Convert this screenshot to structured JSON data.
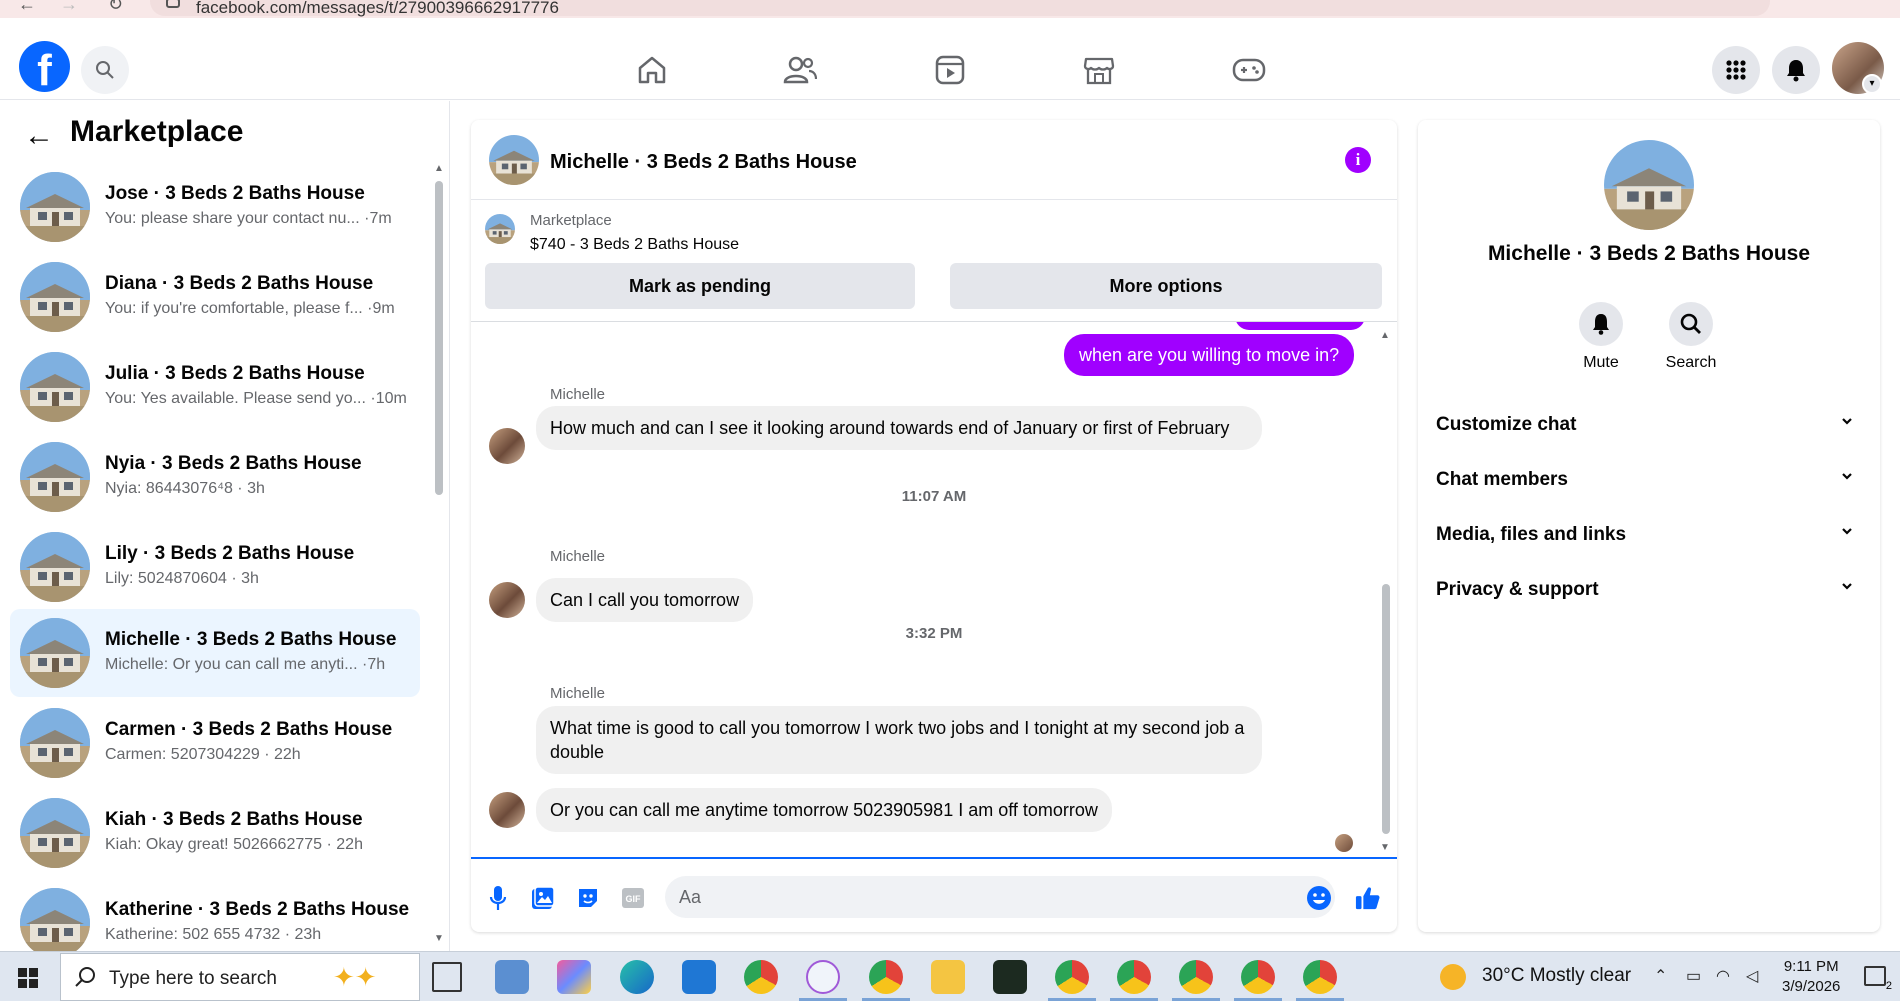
{
  "browser": {
    "url": "facebook.com/messages/t/27900396662917776"
  },
  "topnav": {
    "logo_letter": "f",
    "icons": [
      "search-icon",
      "home-icon",
      "friends-icon",
      "video-icon",
      "marketplace-icon",
      "gaming-icon",
      "apps-grid-icon",
      "notifications-icon"
    ]
  },
  "sidebar": {
    "title": "Marketplace",
    "conversations": [
      {
        "name": "Jose · 3 Beds 2 Baths House",
        "preview": "You: please share your contact nu... ·7m",
        "active": false
      },
      {
        "name": "Diana · 3 Beds 2 Baths House",
        "preview": "You: if you're comfortable, please f... ·9m",
        "active": false
      },
      {
        "name": "Julia · 3 Beds 2 Baths House",
        "preview": "You: Yes available. Please send yo... ·10m",
        "active": false
      },
      {
        "name": "Nyia · 3 Beds 2 Baths House",
        "preview": "Nyia: 86443076⁴8 · 3h",
        "active": false
      },
      {
        "name": "Lily · 3 Beds 2 Baths House",
        "preview": "Lily: 5024870604 · 3h",
        "active": false
      },
      {
        "name": "Michelle · 3 Beds 2 Baths House",
        "preview": "Michelle: Or you can call me anyti... ·7h",
        "active": true
      },
      {
        "name": "Carmen · 3 Beds 2 Baths House",
        "preview": "Carmen: 5207304229 · 22h",
        "active": false
      },
      {
        "name": "Kiah · 3 Beds 2 Baths House",
        "preview": "Kiah: Okay great! 5026662775 · 22h",
        "active": false
      },
      {
        "name": "Katherine · 3 Beds 2 Baths House",
        "preview": "Katherine: 502 655 4732 · 23h",
        "active": false
      }
    ]
  },
  "chat": {
    "title": "Michelle · 3 Beds 2 Baths House",
    "marketplace_label": "Marketplace",
    "listing": "$740 - 3 Beds 2 Baths House",
    "btn_pending": "Mark as pending",
    "btn_more": "More options",
    "outgoing": "when are you willing to move in?",
    "sender": "Michelle",
    "msg1": "How much and can I see it looking around towards end of January or first of February",
    "time1": "11:07 AM",
    "msg2": "Can I call you tomorrow",
    "time2": "3:32 PM",
    "msg3": "What time is good to call you tomorrow I work two jobs and I tonight at my second job a double",
    "msg4": "Or you can call me anytime tomorrow 5023905981 I am off tomorrow",
    "composer_placeholder": "Aa"
  },
  "info_panel": {
    "name": "Michelle · 3 Beds 2 Baths House",
    "mute_label": "Mute",
    "search_label": "Search",
    "sections": [
      "Customize chat",
      "Chat members",
      "Media, files and links",
      "Privacy & support"
    ]
  },
  "taskbar": {
    "search_placeholder": "Type here to search",
    "weather": "30°C  Mostly clear",
    "time": "9:11 PM",
    "date": "3/9/2026",
    "notification_count": "2"
  },
  "colors": {
    "accent_purple": "#a000ff",
    "fb_blue": "#0866ff",
    "active_row": "#ebf5ff"
  }
}
